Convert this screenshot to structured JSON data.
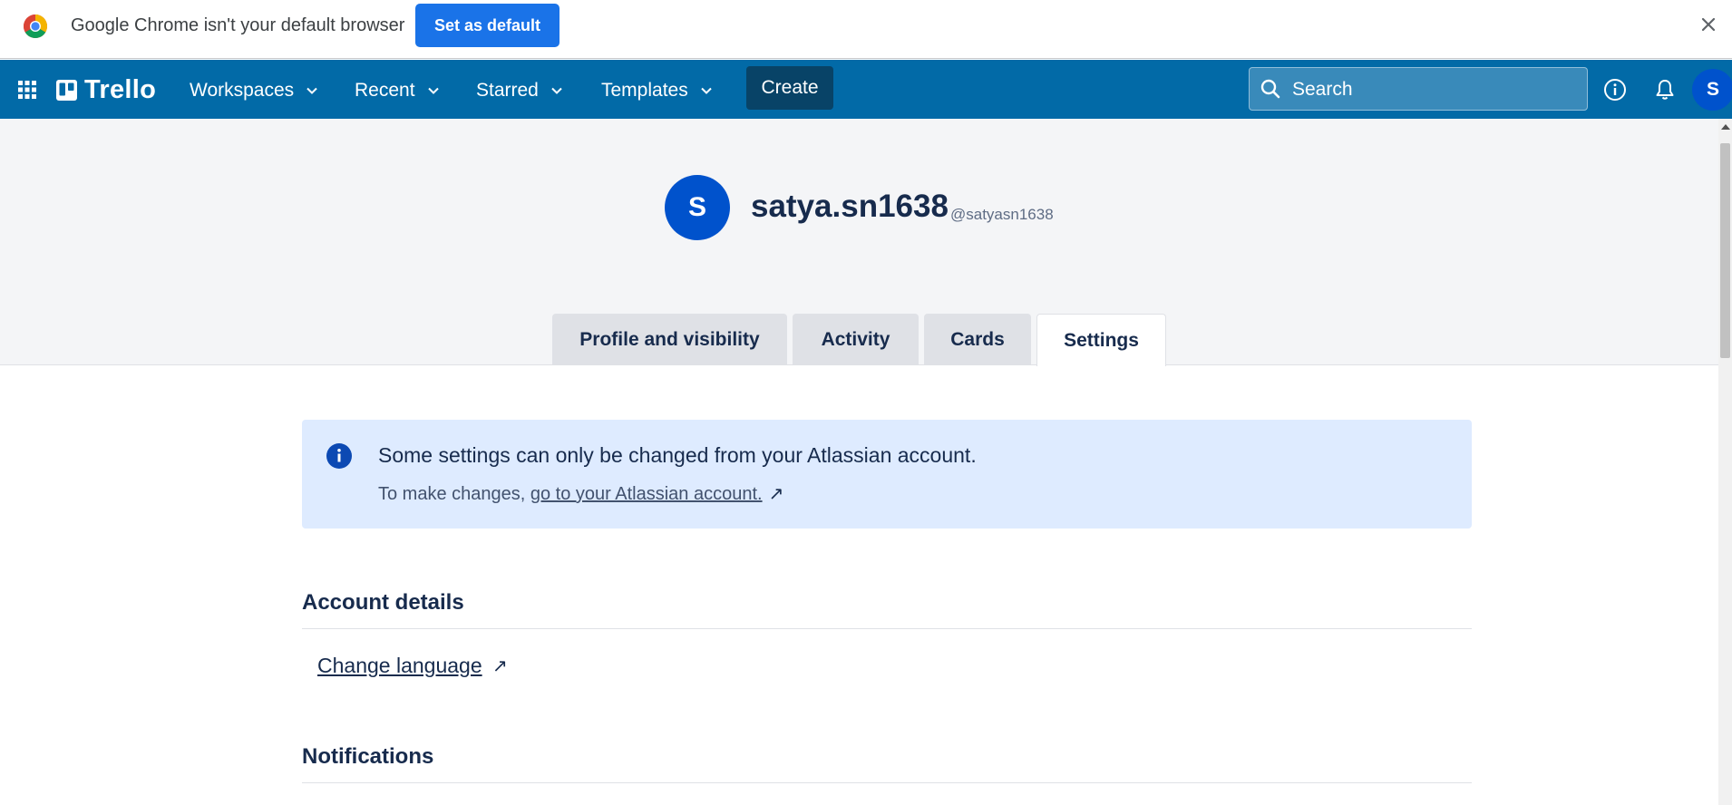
{
  "chrome_infobar": {
    "message": "Google Chrome isn't your default browser",
    "set_default_label": "Set as default",
    "close_icon": "close-icon"
  },
  "header": {
    "logo_text": "Trello",
    "nav": {
      "workspaces": "Workspaces",
      "recent": "Recent",
      "starred": "Starred",
      "templates": "Templates"
    },
    "create_label": "Create",
    "search_placeholder": "Search",
    "avatar_initial": "S",
    "brand_color": "#026aa7"
  },
  "profile": {
    "avatar_initial": "S",
    "display_name": "satya.sn1638",
    "username": "@satyasn1638",
    "avatar_color": "#0052cc"
  },
  "tabs": [
    {
      "label": "Profile and visibility",
      "active": false
    },
    {
      "label": "Activity",
      "active": false
    },
    {
      "label": "Cards",
      "active": false
    },
    {
      "label": "Settings",
      "active": true
    }
  ],
  "info_banner": {
    "title": "Some settings can only be changed from your Atlassian account.",
    "text_prefix": "To make changes, ",
    "link_text": "go to your Atlassian account.",
    "external_arrow": "↗",
    "background": "#deebff"
  },
  "sections": {
    "account_details": {
      "title": "Account details",
      "change_language": "Change language",
      "external_arrow": "↗"
    },
    "notifications": {
      "title": "Notifications"
    }
  }
}
